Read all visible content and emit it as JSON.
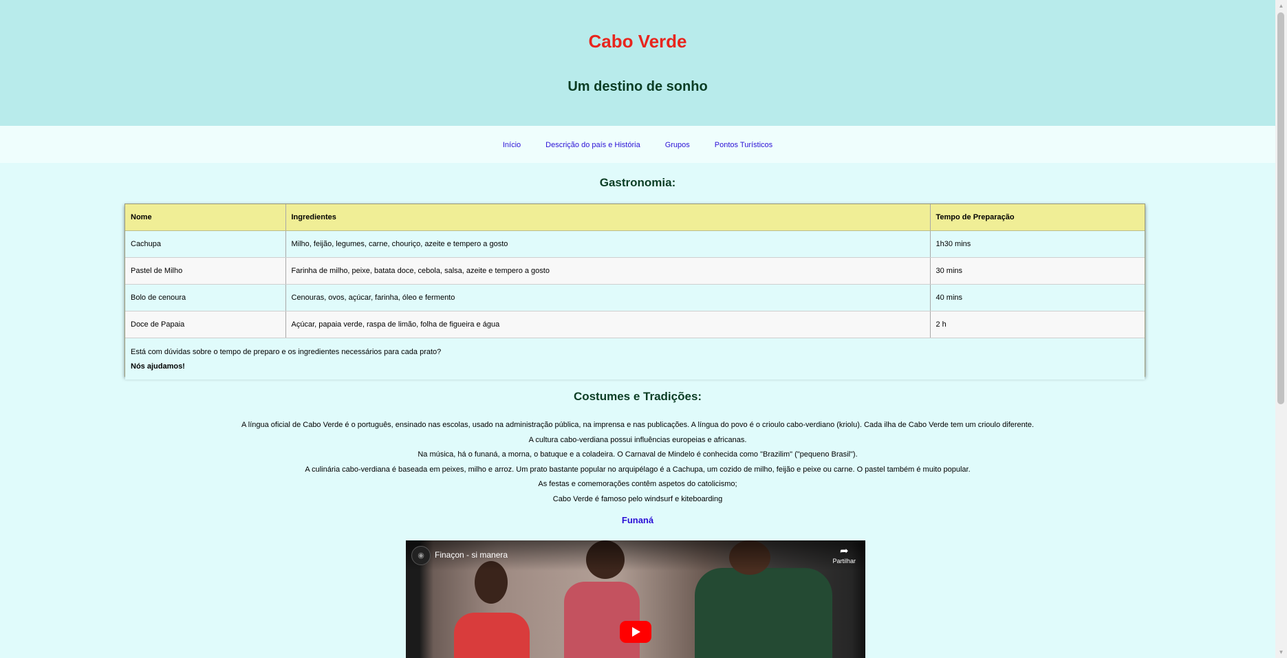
{
  "header": {
    "title": "Cabo Verde",
    "subtitle": "Um destino de sonho"
  },
  "nav": {
    "items": [
      {
        "label": "Início"
      },
      {
        "label": "Descrição do país e História"
      },
      {
        "label": "Grupos"
      },
      {
        "label": "Pontos Turísticos"
      }
    ]
  },
  "gastronomia": {
    "title": "Gastronomia:",
    "columns": [
      "Nome",
      "Ingredientes",
      "Tempo de Preparação"
    ],
    "rows": [
      [
        "Cachupa",
        "Milho, feijão, legumes, carne, chouriço, azeite e tempero a gosto",
        "1h30 mins"
      ],
      [
        "Pastel de Milho",
        "Farinha de milho, peixe, batata doce, cebola, salsa, azeite e tempero a gosto",
        "30 mins"
      ],
      [
        "Bolo de cenoura",
        "Cenouras, ovos, açúcar, farinha, óleo e fermento",
        "40 mins"
      ],
      [
        "Doce de Papaia",
        "Açúcar, papaia verde, raspa de limão, folha de figueira e água",
        "2 h"
      ]
    ],
    "footer_question": "Está com dúvidas sobre o tempo de preparo e os ingredientes necessários para cada prato?",
    "footer_bold": "Nós ajudamos!"
  },
  "costumes": {
    "title": "Costumes e Tradições:",
    "paragraphs": [
      "A língua oficial de Cabo Verde é o português, ensinado nas escolas, usado na administração pública, na imprensa e nas publicações. A língua do povo é o crioulo cabo-verdiano (kriolu). Cada ilha de Cabo Verde tem um crioulo diferente.",
      "A cultura cabo-verdiana possui influências europeias e africanas.",
      "Na música, há o funaná, a morna, o batuque e a coladeira. O Carnaval de Mindelo é conhecida como \"Brazilim\" (\"pequeno Brasil\").",
      "A culinária cabo-verdiana é baseada em peixes, milho e arroz. Um prato bastante popular no arquipélago é a Cachupa, um cozido de milho, feijão e peixe ou carne. O pastel também é muito popular.",
      "As festas e comemorações contêm aspetos do catolicismo;",
      "Cabo Verde é famoso pelo windsurf e kiteboarding"
    ]
  },
  "funana": {
    "label": "Funaná"
  },
  "video": {
    "title": "Finaçon - si manera",
    "share_label": "Partilhar",
    "icons": [
      "channel-avatar-icon",
      "share-icon",
      "play-icon"
    ]
  },
  "colors": {
    "header_bg": "#b8ebeb",
    "title_red": "#e8251d",
    "subtitle_green": "#0b3d24",
    "link_blue": "#2a0fd6",
    "table_header_yellow": "#f0ee96",
    "page_bg": "#e0fbfb"
  }
}
